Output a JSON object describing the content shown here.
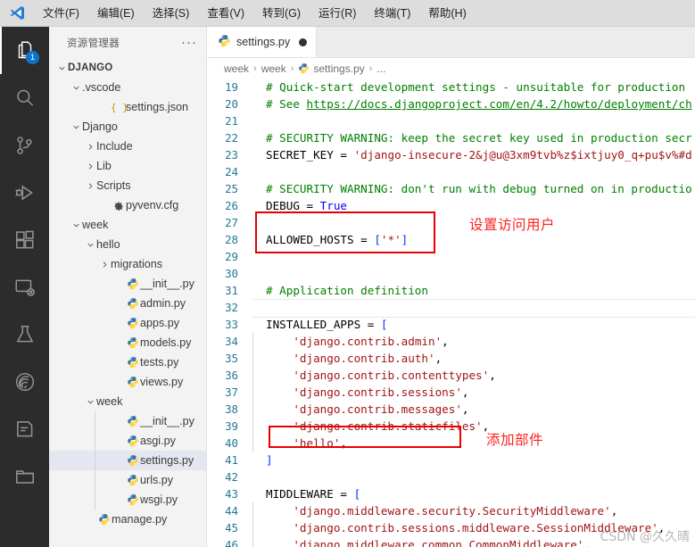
{
  "window": {
    "logo": "vscode-logo"
  },
  "menubar": {
    "items": [
      {
        "label": "文件(F)",
        "name": "menu-file"
      },
      {
        "label": "编辑(E)",
        "name": "menu-edit"
      },
      {
        "label": "选择(S)",
        "name": "menu-selection"
      },
      {
        "label": "查看(V)",
        "name": "menu-view"
      },
      {
        "label": "转到(G)",
        "name": "menu-go"
      },
      {
        "label": "运行(R)",
        "name": "menu-run"
      },
      {
        "label": "终端(T)",
        "name": "menu-terminal"
      },
      {
        "label": "帮助(H)",
        "name": "menu-help"
      }
    ]
  },
  "activitybar": {
    "items": [
      {
        "icon": "explorer-icon",
        "active": true,
        "badge": "1"
      },
      {
        "icon": "search-icon",
        "active": false,
        "badge": ""
      },
      {
        "icon": "source-control-icon",
        "active": false,
        "badge": ""
      },
      {
        "icon": "run-and-debug-icon",
        "active": false,
        "badge": ""
      },
      {
        "icon": "extensions-icon",
        "active": false,
        "badge": ""
      },
      {
        "icon": "remote-explorer-icon",
        "active": false,
        "badge": ""
      },
      {
        "icon": "testing-flask-icon",
        "active": false,
        "badge": ""
      },
      {
        "icon": "fingerprint-icon",
        "active": false,
        "badge": ""
      },
      {
        "icon": "notebook-icon",
        "active": false,
        "badge": ""
      },
      {
        "icon": "folder-icon",
        "active": false,
        "badge": ""
      }
    ]
  },
  "sidebar": {
    "title": "资源管理器",
    "more_actions": "···",
    "tree": [
      {
        "label": "DJANGO",
        "depth": 0,
        "type": "root",
        "chev": "down",
        "icon": "none",
        "selected": false
      },
      {
        "label": ".vscode",
        "depth": 1,
        "type": "folder",
        "chev": "down",
        "icon": "none",
        "selected": false
      },
      {
        "label": "settings.json",
        "depth": 3,
        "type": "file",
        "chev": "none",
        "icon": "json-icon",
        "selected": false
      },
      {
        "label": "Django",
        "depth": 1,
        "type": "folder",
        "chev": "down",
        "icon": "none",
        "selected": false
      },
      {
        "label": "Include",
        "depth": 2,
        "type": "folder",
        "chev": "right",
        "icon": "none",
        "selected": false
      },
      {
        "label": "Lib",
        "depth": 2,
        "type": "folder",
        "chev": "right",
        "icon": "none",
        "selected": false
      },
      {
        "label": "Scripts",
        "depth": 2,
        "type": "folder",
        "chev": "right",
        "icon": "none",
        "selected": false
      },
      {
        "label": "pyvenv.cfg",
        "depth": 3,
        "type": "file",
        "chev": "none",
        "icon": "gear-icon",
        "selected": false
      },
      {
        "label": "week",
        "depth": 1,
        "type": "folder",
        "chev": "down",
        "icon": "none",
        "selected": false
      },
      {
        "label": "hello",
        "depth": 2,
        "type": "folder",
        "chev": "down",
        "icon": "none",
        "selected": false
      },
      {
        "label": "migrations",
        "depth": 3,
        "type": "folder",
        "chev": "right",
        "icon": "none",
        "selected": false
      },
      {
        "label": "__init__.py",
        "depth": 4,
        "type": "file",
        "chev": "none",
        "icon": "python-icon",
        "selected": false
      },
      {
        "label": "admin.py",
        "depth": 4,
        "type": "file",
        "chev": "none",
        "icon": "python-icon",
        "selected": false
      },
      {
        "label": "apps.py",
        "depth": 4,
        "type": "file",
        "chev": "none",
        "icon": "python-icon",
        "selected": false
      },
      {
        "label": "models.py",
        "depth": 4,
        "type": "file",
        "chev": "none",
        "icon": "python-icon",
        "selected": false
      },
      {
        "label": "tests.py",
        "depth": 4,
        "type": "file",
        "chev": "none",
        "icon": "python-icon",
        "selected": false
      },
      {
        "label": "views.py",
        "depth": 4,
        "type": "file",
        "chev": "none",
        "icon": "python-icon",
        "selected": false
      },
      {
        "label": "week",
        "depth": 2,
        "type": "folder",
        "chev": "down",
        "icon": "none",
        "selected": false
      },
      {
        "label": "__init__.py",
        "depth": 4,
        "type": "file",
        "chev": "none",
        "icon": "python-icon",
        "selected": false
      },
      {
        "label": "asgi.py",
        "depth": 4,
        "type": "file",
        "chev": "none",
        "icon": "python-icon",
        "selected": false
      },
      {
        "label": "settings.py",
        "depth": 4,
        "type": "file",
        "chev": "none",
        "icon": "python-icon",
        "selected": true
      },
      {
        "label": "urls.py",
        "depth": 4,
        "type": "file",
        "chev": "none",
        "icon": "python-icon",
        "selected": false
      },
      {
        "label": "wsgi.py",
        "depth": 4,
        "type": "file",
        "chev": "none",
        "icon": "python-icon",
        "selected": false
      },
      {
        "label": "manage.py",
        "depth": 2,
        "type": "file",
        "chev": "none",
        "icon": "python-icon",
        "selected": false
      }
    ]
  },
  "editor": {
    "tab": {
      "label": "settings.py",
      "icon": "python-icon",
      "dirty": true
    },
    "breadcrumbs": [
      "week",
      "week",
      "settings.py",
      "..."
    ],
    "breadcrumb_file_icon": "python-icon",
    "first_visible_line": 19,
    "lines": [
      {
        "n": 19,
        "html": "<span class='cmt'># Quick-start development settings - unsuitable for production</span>"
      },
      {
        "n": 20,
        "html": "<span class='cmt'># See </span><span class='lnk'>https://docs.djangoproject.com/en/4.2/howto/deployment/ch</span>"
      },
      {
        "n": 21,
        "html": ""
      },
      {
        "n": 22,
        "html": "<span class='cmt'># SECURITY WARNING: keep the secret key used in production secr</span>"
      },
      {
        "n": 23,
        "html": "<span class='var'>SECRET_KEY</span> = <span class='str'>'django-insecure-2&amp;j@u@3xm9tvb%z$ixtjuy0_q+pu$v%#d</span>"
      },
      {
        "n": 24,
        "html": ""
      },
      {
        "n": 25,
        "html": "<span class='cmt'># SECURITY WARNING: don't run with debug turned on in productio</span>"
      },
      {
        "n": 26,
        "html": "<span class='var'>DEBUG</span> = <span class='kw'>True</span>"
      },
      {
        "n": 27,
        "html": ""
      },
      {
        "n": 28,
        "html": "<span class='var'>ALLOWED_HOSTS</span> = <span class='brk'>[</span><span class='str'>'*'</span><span class='brk'>]</span>"
      },
      {
        "n": 29,
        "html": ""
      },
      {
        "n": 30,
        "html": ""
      },
      {
        "n": 31,
        "html": "<span class='cmt'># Application definition</span>"
      },
      {
        "n": 32,
        "html": "",
        "current": true
      },
      {
        "n": 33,
        "html": "<span class='var'>INSTALLED_APPS</span> = <span class='brk'>[</span>"
      },
      {
        "n": 34,
        "html": "    <span class='str'>'django.contrib.admin'</span>,",
        "guide": true
      },
      {
        "n": 35,
        "html": "    <span class='str'>'django.contrib.auth'</span>,",
        "guide": true
      },
      {
        "n": 36,
        "html": "    <span class='str'>'django.contrib.contenttypes'</span>,",
        "guide": true
      },
      {
        "n": 37,
        "html": "    <span class='str'>'django.contrib.sessions'</span>,",
        "guide": true
      },
      {
        "n": 38,
        "html": "    <span class='str'>'django.contrib.messages'</span>,",
        "guide": true
      },
      {
        "n": 39,
        "html": "    <span class='str'>'django.contrib.staticfiles'</span>,",
        "guide": true
      },
      {
        "n": 40,
        "html": "    <span class='str'>'hello'</span>,",
        "guide": true
      },
      {
        "n": 41,
        "html": "<span class='brk'>]</span>"
      },
      {
        "n": 42,
        "html": ""
      },
      {
        "n": 43,
        "html": "<span class='var'>MIDDLEWARE</span> = <span class='brk'>[</span>"
      },
      {
        "n": 44,
        "html": "    <span class='str'>'django.middleware.security.SecurityMiddleware'</span>,",
        "guide": true
      },
      {
        "n": 45,
        "html": "    <span class='str'>'django.contrib.sessions.middleware.SessionMiddleware'</span>,",
        "guide": true
      },
      {
        "n": 46,
        "html": "    <span class='str'>'django.middleware.common.CommonMiddleware'</span>,",
        "guide": true
      }
    ]
  },
  "annotations": {
    "allowed_hosts_note": "设置访问用户",
    "installed_apps_note": "添加部件",
    "box_color": "#e60000",
    "text_color": "#ff2020"
  },
  "watermark": {
    "text": "CSDN @久久晴"
  }
}
